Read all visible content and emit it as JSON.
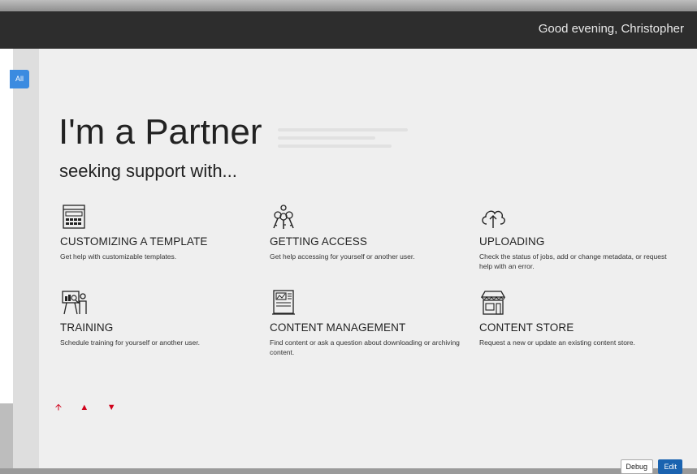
{
  "header": {
    "greeting": "Good evening, Christopher"
  },
  "sidebar": {
    "all_label": "All"
  },
  "hero": {
    "title": "I'm a Partner",
    "subtitle": "seeking support with..."
  },
  "cards": [
    {
      "icon": "template-icon",
      "title": "CUSTOMIZING A TEMPLATE",
      "description": "Get help with customizable templates."
    },
    {
      "icon": "keys-icon",
      "title": "GETTING ACCESS",
      "description": "Get help accessing for yourself or another user."
    },
    {
      "icon": "cloud-upload-icon",
      "title": "UPLOADING",
      "description": "Check the status of jobs, add or change metadata, or request help with an error."
    },
    {
      "icon": "presentation-icon",
      "title": "TRAINING",
      "description": "Schedule training for yourself or another user."
    },
    {
      "icon": "content-management-icon",
      "title": "CONTENT MANAGEMENT",
      "description": "Find content or ask a question about downloading or archiving content."
    },
    {
      "icon": "storefront-icon",
      "title": "CONTENT STORE",
      "description": "Request a new or update an existing content store."
    }
  ],
  "controls": {
    "arrows": [
      "arrow-up-icon",
      "caret-up-icon",
      "caret-down-icon"
    ],
    "arrow_color": "#d0021b"
  },
  "footer": {
    "debug_label": "Debug",
    "edit_label": "Edit"
  }
}
